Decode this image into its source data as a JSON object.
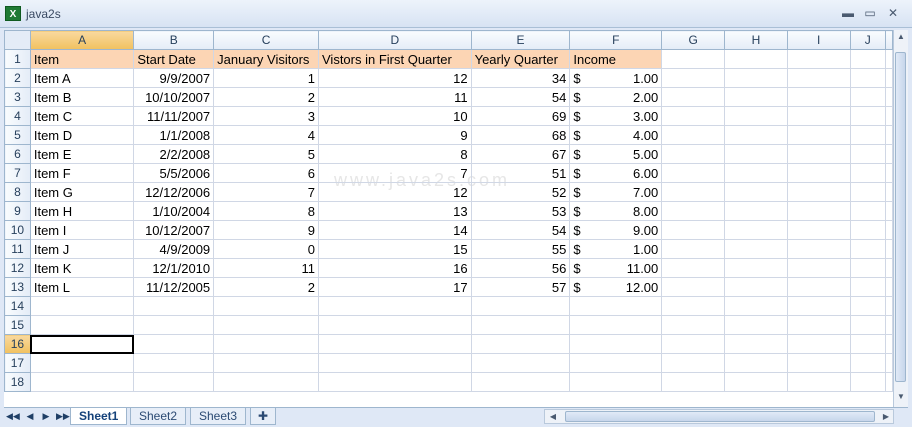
{
  "window": {
    "title": "java2s",
    "app_icon": "excel-icon",
    "minimize": "▬",
    "maximize": "▭",
    "close": "✕"
  },
  "columns": [
    "A",
    "B",
    "C",
    "D",
    "E",
    "F",
    "G",
    "H",
    "I",
    "J"
  ],
  "rows": [
    "1",
    "2",
    "3",
    "4",
    "5",
    "6",
    "7",
    "8",
    "9",
    "10",
    "11",
    "12",
    "13",
    "14",
    "15",
    "16",
    "17",
    "18"
  ],
  "headers": [
    "Item",
    "Start Date",
    "January Visitors",
    "Vistors in First Quarter",
    "Yearly Quarter",
    "Income"
  ],
  "data": [
    [
      "Item A",
      "9/9/2007",
      "1",
      "12",
      "34",
      "1.00"
    ],
    [
      "Item B",
      "10/10/2007",
      "2",
      "11",
      "54",
      "2.00"
    ],
    [
      "Item C",
      "11/11/2007",
      "3",
      "10",
      "69",
      "3.00"
    ],
    [
      "Item D",
      "1/1/2008",
      "4",
      "9",
      "68",
      "4.00"
    ],
    [
      "Item E",
      "2/2/2008",
      "5",
      "8",
      "67",
      "5.00"
    ],
    [
      "Item F",
      "5/5/2006",
      "6",
      "7",
      "51",
      "6.00"
    ],
    [
      "Item G",
      "12/12/2006",
      "7",
      "12",
      "52",
      "7.00"
    ],
    [
      "Item H",
      "1/10/2004",
      "8",
      "13",
      "53",
      "8.00"
    ],
    [
      "Item I",
      "10/12/2007",
      "9",
      "14",
      "54",
      "9.00"
    ],
    [
      "Item J",
      "4/9/2009",
      "0",
      "15",
      "55",
      "1.00"
    ],
    [
      "Item K",
      "12/1/2010",
      "11",
      "16",
      "56",
      "11.00"
    ],
    [
      "Item L",
      "11/12/2005",
      "2",
      "17",
      "57",
      "12.00"
    ]
  ],
  "currency_symbol": "$",
  "watermark": "www.java2s.com",
  "active_cell": "A16",
  "sheets": [
    {
      "label": "Sheet1",
      "active": true
    },
    {
      "label": "Sheet2",
      "active": false
    },
    {
      "label": "Sheet3",
      "active": false
    }
  ],
  "nav": {
    "first": "◀◀",
    "prev": "◀",
    "next": "▶",
    "last": "▶▶"
  },
  "colors": {
    "header_fill": "#fcd5b4",
    "grid_line": "#d0d7e5",
    "selection": "#f1c15f"
  }
}
